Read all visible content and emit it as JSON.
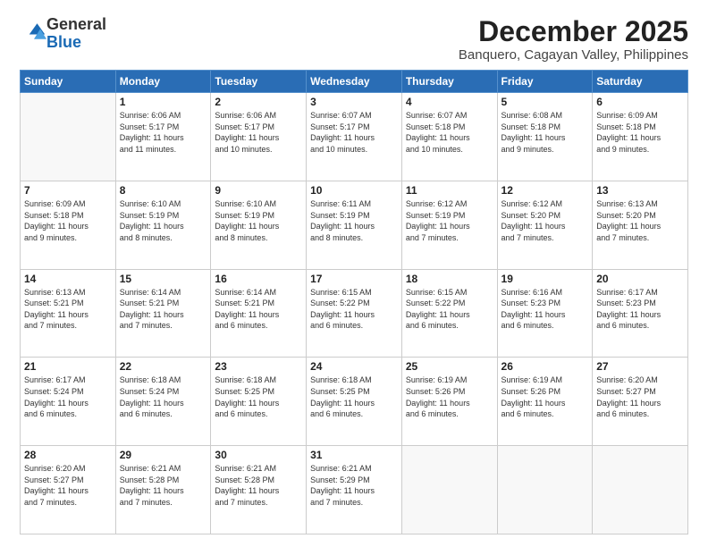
{
  "header": {
    "logo_general": "General",
    "logo_blue": "Blue",
    "month_title": "December 2025",
    "location": "Banquero, Cagayan Valley, Philippines"
  },
  "weekdays": [
    "Sunday",
    "Monday",
    "Tuesday",
    "Wednesday",
    "Thursday",
    "Friday",
    "Saturday"
  ],
  "weeks": [
    [
      {
        "day": "",
        "info": ""
      },
      {
        "day": "1",
        "info": "Sunrise: 6:06 AM\nSunset: 5:17 PM\nDaylight: 11 hours\nand 11 minutes."
      },
      {
        "day": "2",
        "info": "Sunrise: 6:06 AM\nSunset: 5:17 PM\nDaylight: 11 hours\nand 10 minutes."
      },
      {
        "day": "3",
        "info": "Sunrise: 6:07 AM\nSunset: 5:17 PM\nDaylight: 11 hours\nand 10 minutes."
      },
      {
        "day": "4",
        "info": "Sunrise: 6:07 AM\nSunset: 5:18 PM\nDaylight: 11 hours\nand 10 minutes."
      },
      {
        "day": "5",
        "info": "Sunrise: 6:08 AM\nSunset: 5:18 PM\nDaylight: 11 hours\nand 9 minutes."
      },
      {
        "day": "6",
        "info": "Sunrise: 6:09 AM\nSunset: 5:18 PM\nDaylight: 11 hours\nand 9 minutes."
      }
    ],
    [
      {
        "day": "7",
        "info": "Sunrise: 6:09 AM\nSunset: 5:18 PM\nDaylight: 11 hours\nand 9 minutes."
      },
      {
        "day": "8",
        "info": "Sunrise: 6:10 AM\nSunset: 5:19 PM\nDaylight: 11 hours\nand 8 minutes."
      },
      {
        "day": "9",
        "info": "Sunrise: 6:10 AM\nSunset: 5:19 PM\nDaylight: 11 hours\nand 8 minutes."
      },
      {
        "day": "10",
        "info": "Sunrise: 6:11 AM\nSunset: 5:19 PM\nDaylight: 11 hours\nand 8 minutes."
      },
      {
        "day": "11",
        "info": "Sunrise: 6:12 AM\nSunset: 5:19 PM\nDaylight: 11 hours\nand 7 minutes."
      },
      {
        "day": "12",
        "info": "Sunrise: 6:12 AM\nSunset: 5:20 PM\nDaylight: 11 hours\nand 7 minutes."
      },
      {
        "day": "13",
        "info": "Sunrise: 6:13 AM\nSunset: 5:20 PM\nDaylight: 11 hours\nand 7 minutes."
      }
    ],
    [
      {
        "day": "14",
        "info": "Sunrise: 6:13 AM\nSunset: 5:21 PM\nDaylight: 11 hours\nand 7 minutes."
      },
      {
        "day": "15",
        "info": "Sunrise: 6:14 AM\nSunset: 5:21 PM\nDaylight: 11 hours\nand 7 minutes."
      },
      {
        "day": "16",
        "info": "Sunrise: 6:14 AM\nSunset: 5:21 PM\nDaylight: 11 hours\nand 6 minutes."
      },
      {
        "day": "17",
        "info": "Sunrise: 6:15 AM\nSunset: 5:22 PM\nDaylight: 11 hours\nand 6 minutes."
      },
      {
        "day": "18",
        "info": "Sunrise: 6:15 AM\nSunset: 5:22 PM\nDaylight: 11 hours\nand 6 minutes."
      },
      {
        "day": "19",
        "info": "Sunrise: 6:16 AM\nSunset: 5:23 PM\nDaylight: 11 hours\nand 6 minutes."
      },
      {
        "day": "20",
        "info": "Sunrise: 6:17 AM\nSunset: 5:23 PM\nDaylight: 11 hours\nand 6 minutes."
      }
    ],
    [
      {
        "day": "21",
        "info": "Sunrise: 6:17 AM\nSunset: 5:24 PM\nDaylight: 11 hours\nand 6 minutes."
      },
      {
        "day": "22",
        "info": "Sunrise: 6:18 AM\nSunset: 5:24 PM\nDaylight: 11 hours\nand 6 minutes."
      },
      {
        "day": "23",
        "info": "Sunrise: 6:18 AM\nSunset: 5:25 PM\nDaylight: 11 hours\nand 6 minutes."
      },
      {
        "day": "24",
        "info": "Sunrise: 6:18 AM\nSunset: 5:25 PM\nDaylight: 11 hours\nand 6 minutes."
      },
      {
        "day": "25",
        "info": "Sunrise: 6:19 AM\nSunset: 5:26 PM\nDaylight: 11 hours\nand 6 minutes."
      },
      {
        "day": "26",
        "info": "Sunrise: 6:19 AM\nSunset: 5:26 PM\nDaylight: 11 hours\nand 6 minutes."
      },
      {
        "day": "27",
        "info": "Sunrise: 6:20 AM\nSunset: 5:27 PM\nDaylight: 11 hours\nand 6 minutes."
      }
    ],
    [
      {
        "day": "28",
        "info": "Sunrise: 6:20 AM\nSunset: 5:27 PM\nDaylight: 11 hours\nand 7 minutes."
      },
      {
        "day": "29",
        "info": "Sunrise: 6:21 AM\nSunset: 5:28 PM\nDaylight: 11 hours\nand 7 minutes."
      },
      {
        "day": "30",
        "info": "Sunrise: 6:21 AM\nSunset: 5:28 PM\nDaylight: 11 hours\nand 7 minutes."
      },
      {
        "day": "31",
        "info": "Sunrise: 6:21 AM\nSunset: 5:29 PM\nDaylight: 11 hours\nand 7 minutes."
      },
      {
        "day": "",
        "info": ""
      },
      {
        "day": "",
        "info": ""
      },
      {
        "day": "",
        "info": ""
      }
    ]
  ]
}
